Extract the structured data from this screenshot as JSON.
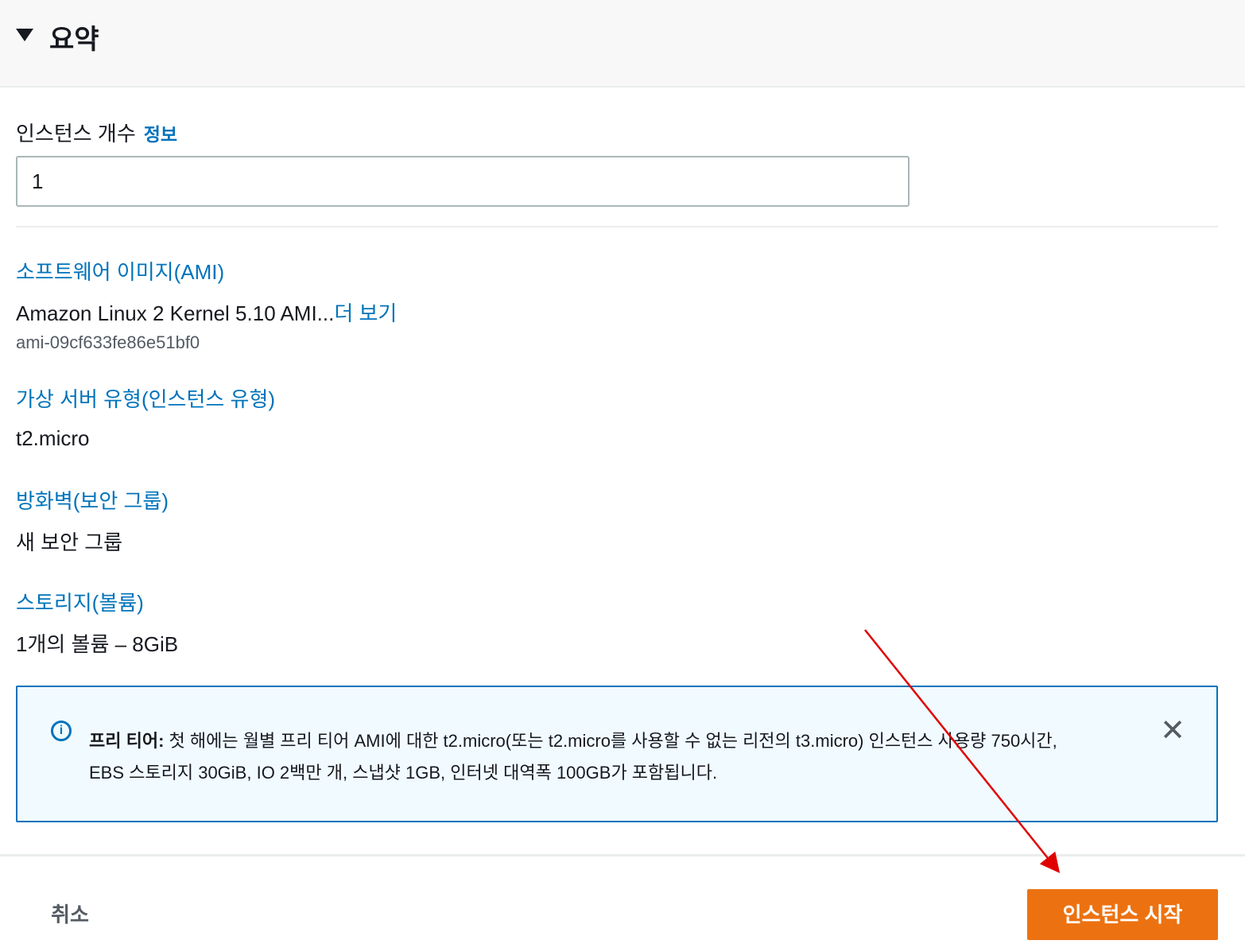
{
  "header": {
    "title": "요약"
  },
  "instance_count": {
    "label": "인스턴스 개수",
    "info_link": "정보",
    "value": "1"
  },
  "ami": {
    "title": "소프트웨어 이미지(AMI)",
    "value": "Amazon Linux 2 Kernel 5.10 AMI...",
    "more_link": "더 보기",
    "id": "ami-09cf633fe86e51bf0"
  },
  "instance_type": {
    "title": "가상 서버 유형(인스턴스 유형)",
    "value": "t2.micro"
  },
  "firewall": {
    "title": "방화벽(보안 그룹)",
    "value": "새 보안 그룹"
  },
  "storage": {
    "title": "스토리지(볼륨)",
    "value": "1개의 볼륨 – 8GiB"
  },
  "free_tier_alert": {
    "label": "프리 티어:",
    "line1": "첫 해에는 월별 프리 티어 AMI에 대한 t2.micro(또는 t2.micro를 사용할 수 없는 리전의 t3.micro) 인스턴스 사용량 750시간,",
    "line2": "EBS 스토리지 30GiB, IO 2백만 개, 스냅샷 1GB, 인터넷 대역폭 100GB가 포함됩니다."
  },
  "footer": {
    "cancel_label": "취소",
    "launch_label": "인스턴스 시작"
  },
  "icons": {
    "collapse": "caret-down-icon",
    "info": "info-circle-icon",
    "close": "close-icon"
  },
  "colors": {
    "accent": "#0073bb",
    "primary_button": "#ec7211",
    "annotation_arrow": "#e00000"
  }
}
